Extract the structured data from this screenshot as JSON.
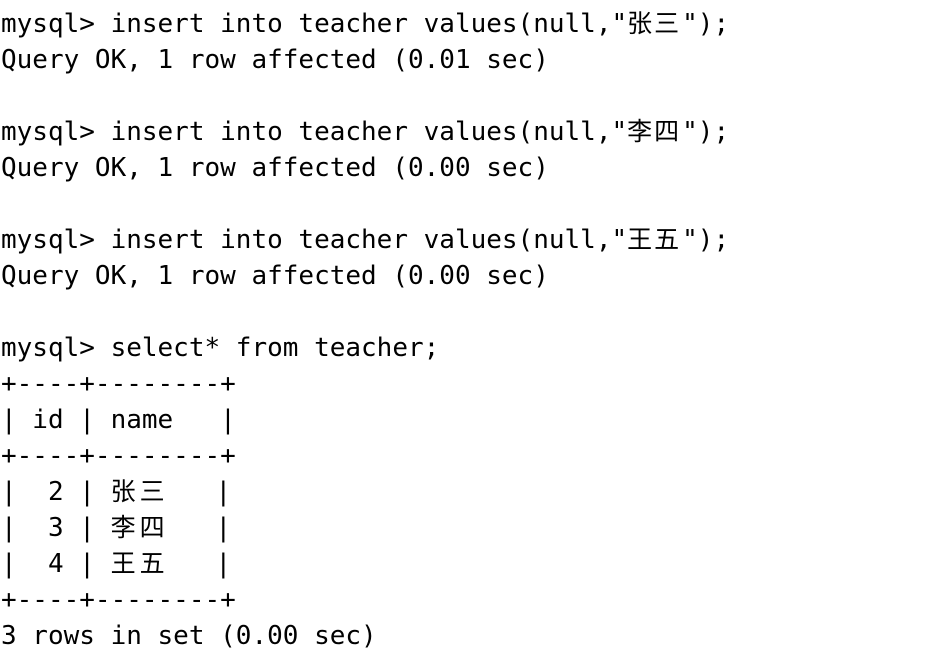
{
  "terminal": {
    "prompt": "mysql>",
    "background_color": "#ffffff",
    "text_color": "#000000",
    "lines": [
      {
        "id": "cmd-insert-1",
        "type": "command",
        "prefix": "mysql> insert into teacher values(null,\"",
        "cjk": "张三",
        "suffix": "\");",
        "full": "mysql> insert into teacher values(null,\"张三\");"
      },
      {
        "id": "result-insert-1",
        "type": "result",
        "full": "Query OK, 1 row affected (0.01 sec)"
      },
      {
        "id": "blank-1",
        "type": "blank",
        "full": ""
      },
      {
        "id": "cmd-insert-2",
        "type": "command",
        "prefix": "mysql> insert into teacher values(null,\"",
        "cjk": "李四",
        "suffix": "\");",
        "full": "mysql> insert into teacher values(null,\"李四\");"
      },
      {
        "id": "result-insert-2",
        "type": "result",
        "full": "Query OK, 1 row affected (0.00 sec)"
      },
      {
        "id": "blank-2",
        "type": "blank",
        "full": ""
      },
      {
        "id": "cmd-insert-3",
        "type": "command",
        "prefix": "mysql> insert into teacher values(null,\"",
        "cjk": "王五",
        "suffix": "\");",
        "full": "mysql> insert into teacher values(null,\"王五\");"
      },
      {
        "id": "result-insert-3",
        "type": "result",
        "full": "Query OK, 1 row affected (0.00 sec)"
      },
      {
        "id": "blank-3",
        "type": "blank",
        "full": ""
      },
      {
        "id": "cmd-select",
        "type": "command",
        "full": "mysql> select* from teacher;"
      }
    ],
    "result_table": {
      "border_top": "+----+--------+",
      "header_row": "| id | name   |",
      "border_mid": "+----+--------+",
      "rows": [
        {
          "left": "|  2 | ",
          "cjk": "张三",
          "right": "   |",
          "id": "2",
          "name": "张三"
        },
        {
          "left": "|  3 | ",
          "cjk": "李四",
          "right": "   |",
          "id": "3",
          "name": "李四"
        },
        {
          "left": "|  4 | ",
          "cjk": "王五",
          "right": "   |",
          "id": "4",
          "name": "王五"
        }
      ],
      "border_bottom": "+----+--------+",
      "columns": [
        "id",
        "name"
      ]
    },
    "footer": "3 rows in set (0.00 sec)"
  }
}
